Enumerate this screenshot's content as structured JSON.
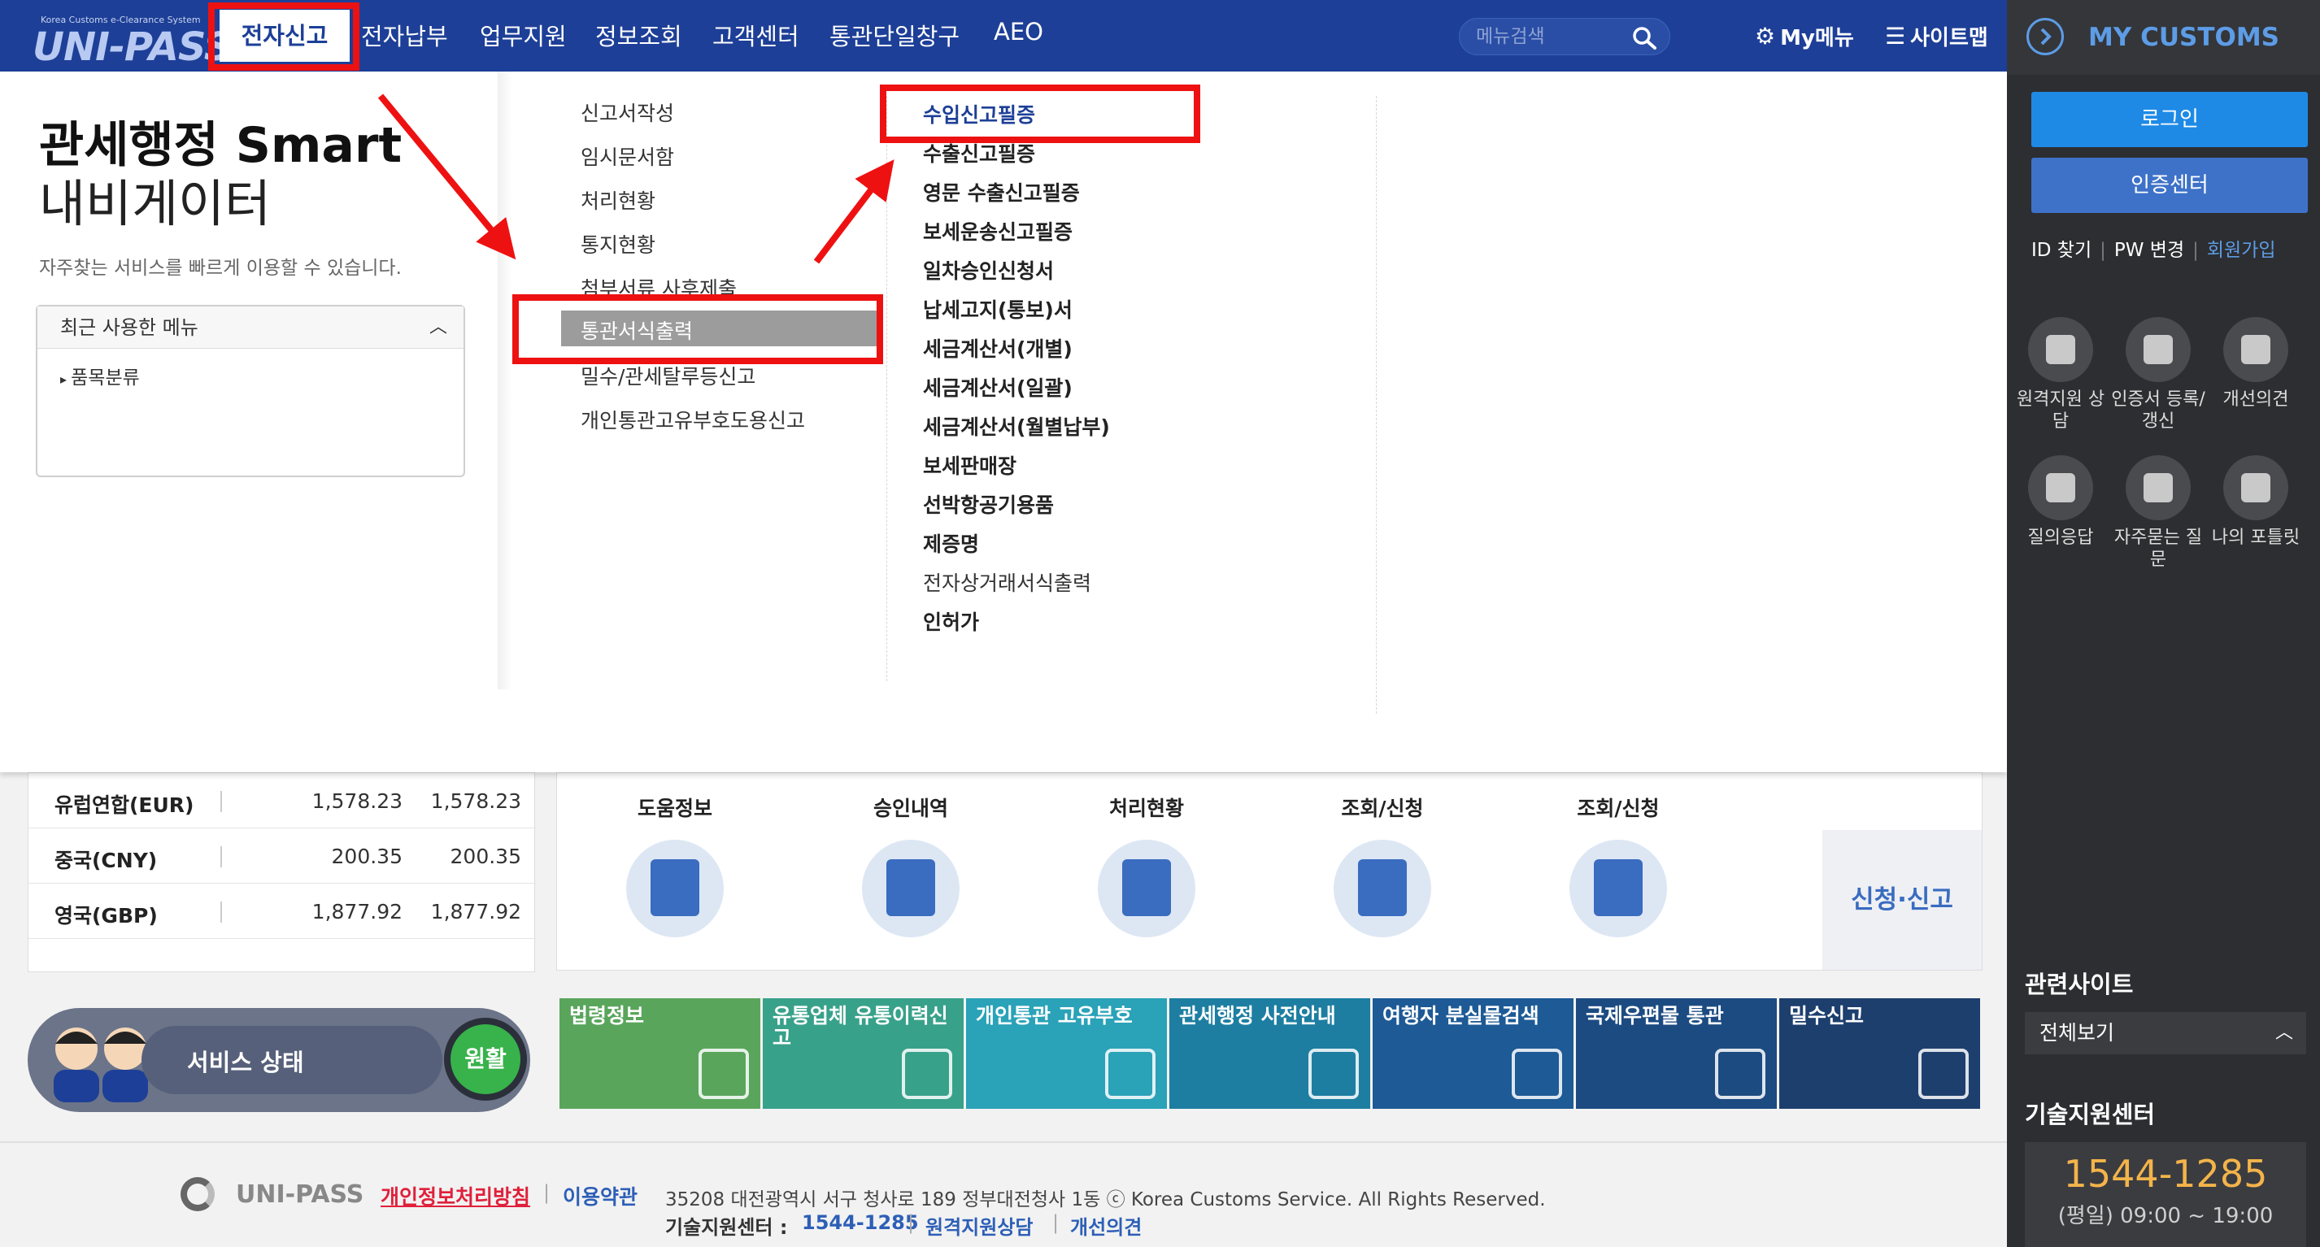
{
  "brand": {
    "tagline": "Korea Customs e-Clearance System",
    "name": "UNI-PASS"
  },
  "nav": {
    "items": [
      "전자신고",
      "전자납부",
      "업무지원",
      "정보조회",
      "고객센터",
      "통관단일창구",
      "AEO"
    ],
    "search_placeholder": "메뉴검색",
    "my_menu": "My메뉴",
    "sitemap": "사이트맵"
  },
  "side_panel": {
    "title": "MY CUSTOMS",
    "login": "로그인",
    "cert_center": "인증센터",
    "find_id": "ID 찾기",
    "pw_change": "PW 변경",
    "join": "회원가입",
    "quick": [
      {
        "label": "원격지원 상담",
        "icon": "remote-support-icon"
      },
      {
        "label": "인증서 등록/갱신",
        "icon": "certificate-icon"
      },
      {
        "label": "개선의견",
        "icon": "feedback-icon"
      },
      {
        "label": "질의응답",
        "icon": "qna-icon"
      },
      {
        "label": "자주묻는 질문",
        "icon": "faq-icon"
      },
      {
        "label": "나의 포틀릿",
        "icon": "portlet-icon"
      }
    ],
    "related_title": "관련사이트",
    "related_select": "전체보기",
    "tech_title": "기술지원센터",
    "phone": "1544-1285",
    "hours": "(평일) 09:00 ~ 19:00"
  },
  "mega": {
    "title_line1": "관세행정 Smart",
    "title_line2": "내비게이터",
    "desc": "자주찾는 서비스를 빠르게 이용할 수 있습니다.",
    "recent_title": "최근 사용한 메뉴",
    "recent_items": [
      "품목분류"
    ],
    "col2": [
      "신고서작성",
      "임시문서함",
      "처리현황",
      "통지현황",
      "첨부서류 사후제출",
      "통관서식출력",
      "밀수/관세탈루등신고",
      "개인통관고유부호도용신고"
    ],
    "col3": [
      "수입신고필증",
      "수출신고필증",
      "영문 수출신고필증",
      "보세운송신고필증",
      "일차승인신청서",
      "납세고지(통보)서",
      "세금계산서(개별)",
      "세금계산서(일괄)",
      "세금계산서(월별납부)",
      "보세판매장",
      "선박항공기용품",
      "제증명",
      "전자상거래서식출력",
      "인허가"
    ]
  },
  "rates": [
    {
      "cur": "유럽연합(EUR)",
      "v1": "1,578.23",
      "v2": "1,578.23"
    },
    {
      "cur": "중국(CNY)",
      "v1": "200.35",
      "v2": "200.35"
    },
    {
      "cur": "영국(GBP)",
      "v1": "1,877.92",
      "v2": "1,877.92"
    }
  ],
  "services": [
    {
      "label": "도움정보",
      "icon": "help-book-icon"
    },
    {
      "label": "승인내역",
      "icon": "import-document-icon"
    },
    {
      "label": "처리현황",
      "icon": "percent-document-icon"
    },
    {
      "label": "조회/신청",
      "icon": "barcode-search-icon"
    },
    {
      "label": "조회/신청",
      "icon": "globe-search-icon"
    }
  ],
  "apply_label": "신청·신고",
  "status": {
    "label": "서비스 상태",
    "value": "원활"
  },
  "tiles": [
    {
      "label": "법령정보",
      "color": "#5aa55c",
      "icon": "open-book-icon"
    },
    {
      "label": "유통업체 유통이력신고",
      "color": "#38a18a",
      "icon": "stamp-icon"
    },
    {
      "label": "개인통관 고유부호",
      "color": "#2aa2b8",
      "icon": "barcode-icon"
    },
    {
      "label": "관세행정 사전안내",
      "color": "#1d7ea1",
      "icon": "operator-icon"
    },
    {
      "label": "여행자 분실물검색",
      "color": "#1d5a96",
      "icon": "box-icon"
    },
    {
      "label": "국제우편물 통관",
      "color": "#1c4b82",
      "icon": "cart-icon"
    },
    {
      "label": "밀수신고",
      "color": "#1d3f6e",
      "icon": "phone-24h-icon"
    }
  ],
  "footer": {
    "logo": "UNI-PASS",
    "privacy": "개인정보처리방침",
    "terms": "이용약관",
    "address": "35208 대전광역시 서구 청사로 189 정부대전청사 1동 ⓒ Korea Customs Service. All Rights Reserved.",
    "tech_label": "기술지원센터 :",
    "tech_number": "1544-1285",
    "remote": "원격지원상담",
    "improve": "개선의견"
  },
  "colors": {
    "nav_bg": "#1d3f97",
    "side_bg": "#2d2e31",
    "accent_blue": "#1e8ae6",
    "annotation_red": "#ee1111"
  }
}
